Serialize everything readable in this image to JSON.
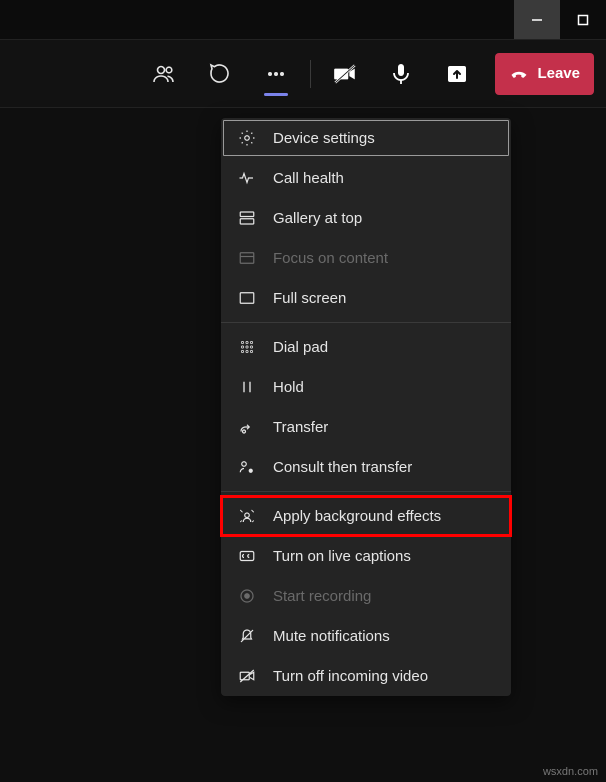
{
  "window": {
    "minimize": "–",
    "maximize": "□"
  },
  "toolbar": {
    "leave_label": "Leave"
  },
  "menu": {
    "device_settings": "Device settings",
    "call_health": "Call health",
    "gallery_at_top": "Gallery at top",
    "focus_on_content": "Focus on content",
    "full_screen": "Full screen",
    "dial_pad": "Dial pad",
    "hold": "Hold",
    "transfer": "Transfer",
    "consult_then_transfer": "Consult then transfer",
    "apply_background_effects": "Apply background effects",
    "turn_on_live_captions": "Turn on live captions",
    "start_recording": "Start recording",
    "mute_notifications": "Mute notifications",
    "turn_off_incoming_video": "Turn off incoming video"
  },
  "watermark": "wsxdn.com"
}
